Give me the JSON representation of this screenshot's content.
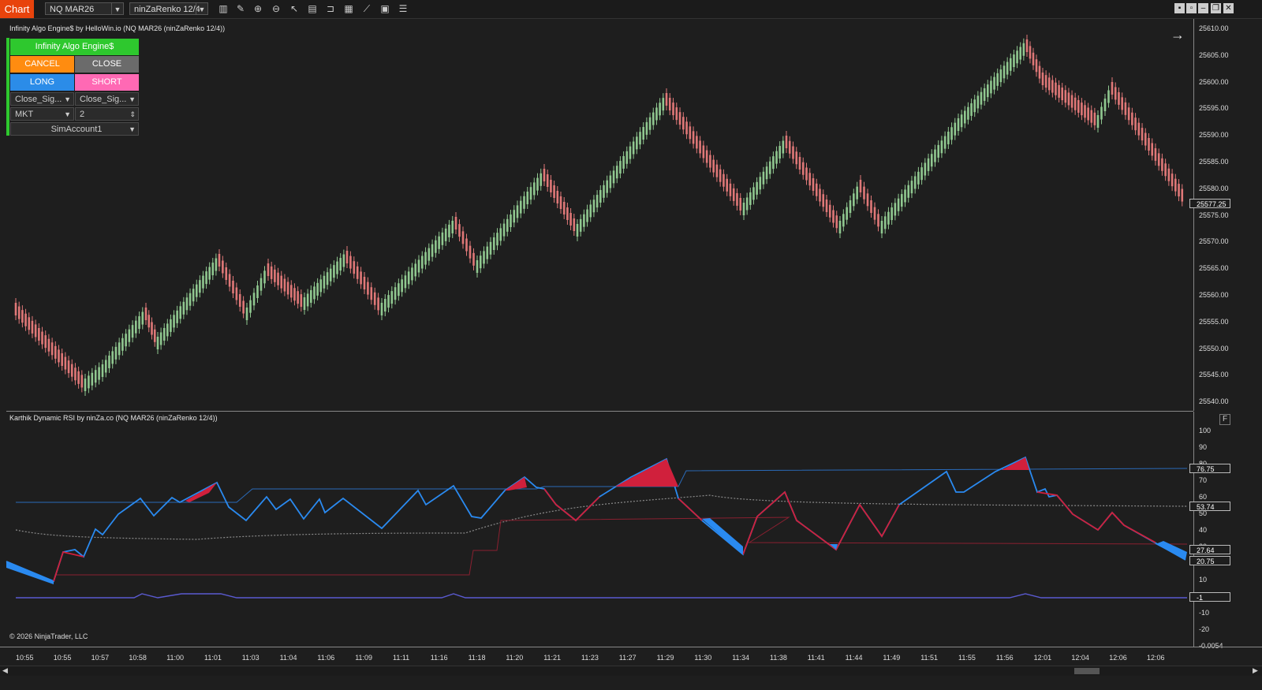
{
  "toolbar": {
    "chart_tab": "Chart",
    "instrument": "NQ MAR26",
    "bar_type": "ninZaRenko 12/4",
    "icons": [
      "bars-icon",
      "pencil-icon",
      "zoom-in-icon",
      "zoom-out-icon",
      "pointer-icon",
      "properties-icon",
      "template-icon",
      "data-box-icon",
      "strategies-icon",
      "calculator-icon",
      "list-icon"
    ]
  },
  "price_panel": {
    "title": "Infinity Algo Engine$ by HelloWin.io (NQ MAR26 (ninZaRenko 12/4))",
    "price_ticks": [
      "25610.00",
      "25605.00",
      "25600.00",
      "25595.00",
      "25590.00",
      "25585.00",
      "25580.00",
      "25575.00",
      "25570.00",
      "25565.00",
      "25560.00",
      "25555.00",
      "25550.00",
      "25545.00",
      "25540.00"
    ],
    "last_price": "25577.25"
  },
  "control_panel": {
    "header": "Infinity Algo Engine$",
    "cancel": "CANCEL",
    "close": "CLOSE",
    "long": "LONG",
    "short": "SHORT",
    "signal_left": "Close_Sig...",
    "signal_right": "Close_Sig...",
    "order_type": "MKT",
    "quantity": "2",
    "account": "SimAccount1",
    "colors": {
      "header": "#2ec82e",
      "cancel": "#ff8c10",
      "close": "#6b6b6b",
      "long": "#2b8ce8",
      "short": "#ff69b4"
    }
  },
  "rsi_panel": {
    "title": "Karthik Dynamic RSI by ninZa.co (NQ MAR26 (ninZaRenko 12/4))",
    "ticks": [
      "100",
      "90",
      "80",
      "70",
      "60",
      "50",
      "40",
      "30",
      "20",
      "10",
      "0",
      "-10",
      "-20",
      "-0.0054"
    ],
    "flags": [
      "76.75",
      "53.74",
      "27.64",
      "20.75",
      "-1"
    ],
    "f_button": "F"
  },
  "time_axis": [
    "10:55",
    "10:55",
    "10:57",
    "10:58",
    "11:00",
    "11:01",
    "11:03",
    "11:04",
    "11:06",
    "11:09",
    "11:11",
    "11:16",
    "11:18",
    "11:20",
    "11:21",
    "11:23",
    "11:27",
    "11:29",
    "11:30",
    "11:34",
    "11:38",
    "11:41",
    "11:44",
    "11:49",
    "11:51",
    "11:55",
    "11:56",
    "12:01",
    "12:04",
    "12:06",
    "12:06"
  ],
  "copyright": "© 2026 NinjaTrader, LLC",
  "colors": {
    "up": "#90c890",
    "down": "#e07878",
    "rsi_up": "#2a8af0",
    "rsi_down": "#d0203c",
    "background": "#1e1e1e"
  }
}
